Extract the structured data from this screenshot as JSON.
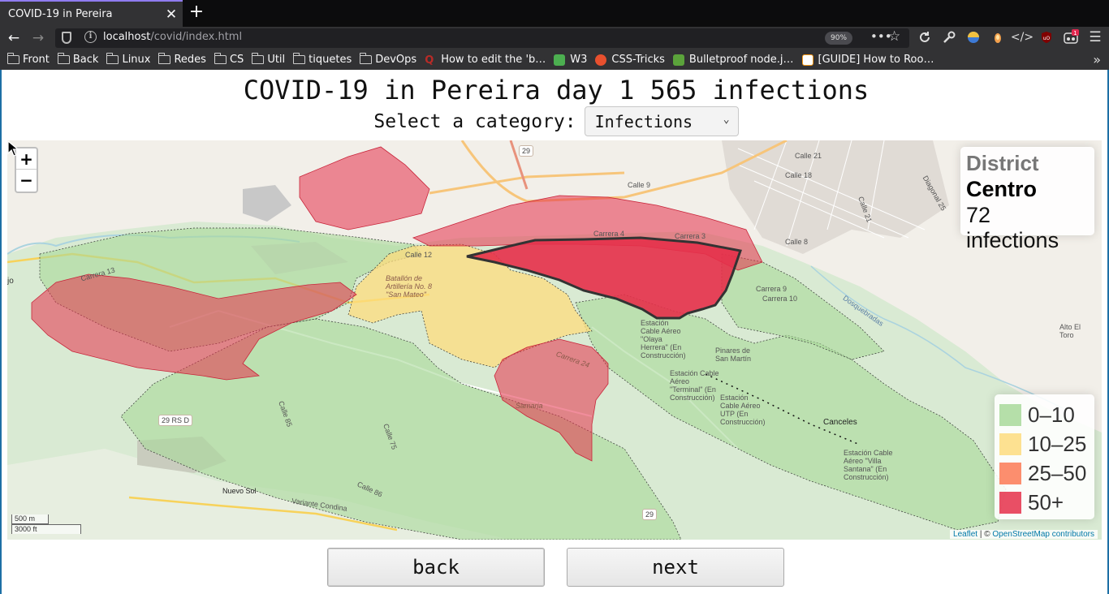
{
  "browser": {
    "tab_title": "COVID-19 in Pereira",
    "url_host": "localhost",
    "url_path": "/covid/index.html",
    "zoom": "90%",
    "bookmarks": [
      {
        "label": "Front",
        "icon": "folder-icon"
      },
      {
        "label": "Back",
        "icon": "folder-icon"
      },
      {
        "label": "Linux",
        "icon": "folder-icon"
      },
      {
        "label": "Redes",
        "icon": "folder-icon"
      },
      {
        "label": "CS",
        "icon": "folder-icon"
      },
      {
        "label": "Util",
        "icon": "folder-icon"
      },
      {
        "label": "tiquetes",
        "icon": "folder-icon"
      },
      {
        "label": "DevOps",
        "icon": "folder-icon"
      },
      {
        "label": "How to edit the 'b…",
        "icon": "quora-icon"
      },
      {
        "label": "W3",
        "icon": "w3-icon"
      },
      {
        "label": "CSS-Tricks",
        "icon": "css-tricks-icon"
      },
      {
        "label": "Bulletproof node.j…",
        "icon": "bulletproof-icon"
      },
      {
        "label": "[GUIDE] How to Roo…",
        "icon": "xda-icon"
      }
    ],
    "notification_count": "1"
  },
  "page": {
    "title": "COVID-19 in Pereira  day 1 565 infections",
    "category_label": "Select a category:",
    "category_selected": "Infections",
    "back_label": "back",
    "next_label": "next"
  },
  "map": {
    "info": {
      "heading": "District",
      "district": "Centro",
      "value": "72 infections"
    },
    "legend": [
      {
        "label": "0–10",
        "color": "#a8d99a"
      },
      {
        "label": "10–25",
        "color": "#fddc7e"
      },
      {
        "label": "25–50",
        "color": "#fc7a55"
      },
      {
        "label": "50+",
        "color": "#e5304a"
      }
    ],
    "zoom_in": "+",
    "zoom_out": "−",
    "scale_metric": "500 m",
    "scale_imperial": "3000 ft",
    "attribution_leaflet": "Leaflet",
    "attribution_sep": " | © ",
    "attribution_osm": "OpenStreetMap contributors",
    "labels": {
      "calle9": "Calle 9",
      "carrera4": "Carrera 4",
      "carrera3": "Carrera 3",
      "calle12": "Calle 12",
      "calle18": "Calle 18",
      "calle21": "Calle 21",
      "diagonal25": "Diagonal 25",
      "calle8": "Calle 8",
      "carrera13": "Carrera 13",
      "carrera9": "Carrera 9",
      "carrera10": "Carrera 10",
      "dosquebradas": "Dosquebradas",
      "batallon": "Batallón de Artillería No. 8 \"San Mateo\"",
      "estacion_olaya": "Estación Cable Aéreo \"Olaya Herrera\" (En Construcción)",
      "estacion_terminal": "Estación Cable Aéreo \"Terminal\" (En Construcción)",
      "estacion_utp": "Estación Cable Aéreo UTP (En Construcción)",
      "estacion_villa": "Estación Cable Aéreo \"Villa Santana\" (En Construcción)",
      "pinares": "Pinares de San Martín",
      "carrera24": "Carrera 24",
      "samaria": "Samaria",
      "canceles": "Canceles",
      "nuevo_sol": "Nuevo Sol",
      "variante": "Variante Condina",
      "alto_toro": "Alto El Toro",
      "route29": "29",
      "route29rsd": "29 RS D",
      "route29b": "29",
      "calle85": "Calle 85",
      "calle86": "Calle 86",
      "calle75": "Calle 75",
      "jo": "jo"
    }
  }
}
